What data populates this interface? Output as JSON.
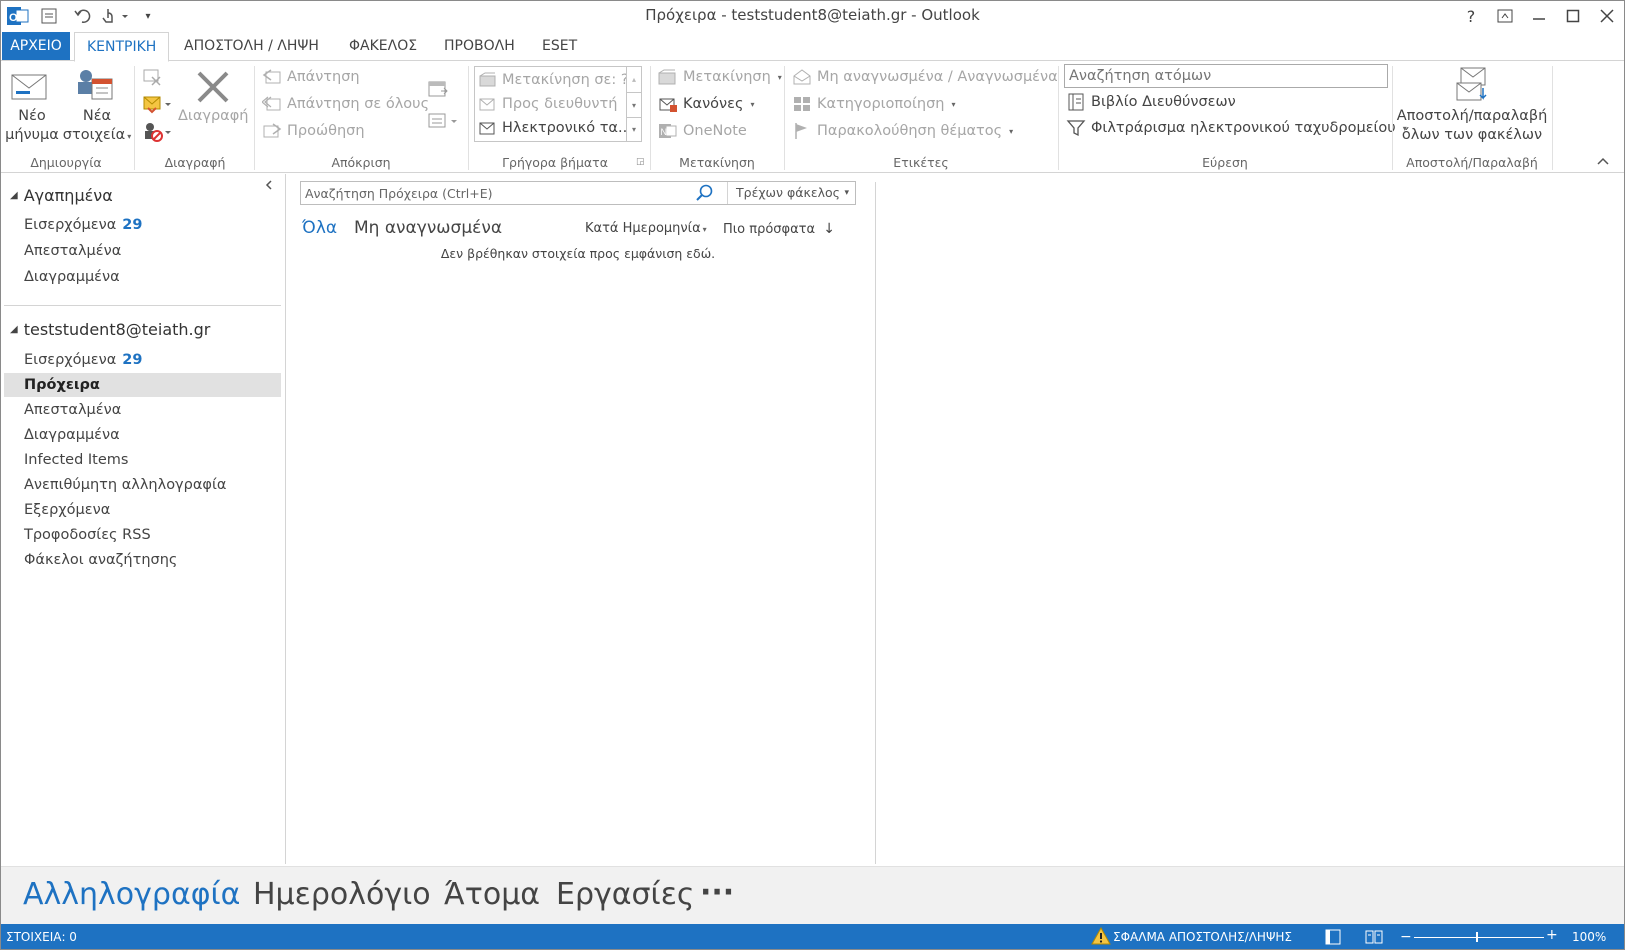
{
  "window": {
    "title": "Πρόχειρα - teststudent8@teiath.gr - Outlook",
    "help": "?"
  },
  "tabs": {
    "file": "ΑΡΧΕΙΟ",
    "home": "ΚΕΝΤΡΙΚΗ",
    "send_receive": "ΑΠΟΣΤΟΛΗ / ΛΗΨΗ",
    "folder": "ΦΑΚΕΛΟΣ",
    "view": "ΠΡΟΒΟΛΗ",
    "eset": "ESET"
  },
  "ribbon": {
    "new": {
      "new_email_line1": "Νέο",
      "new_email_line2": "μήνυμα",
      "new_items_line1": "Νέα",
      "new_items_line2": "στοιχεία",
      "label": "Δημιουργία"
    },
    "delete": {
      "delete": "Διαγραφή",
      "label": "Διαγραφή"
    },
    "respond": {
      "reply": "Απάντηση",
      "reply_all": "Απάντηση σε όλους",
      "forward": "Προώθηση",
      "label": "Απόκριση"
    },
    "quick_steps": {
      "move_to": "Μετακίνηση σε: ?",
      "to_manager": "Προς διευθυντή",
      "team_email": "Ηλεκτρονικό τα...",
      "label": "Γρήγορα βήματα"
    },
    "move": {
      "move": "Μετακίνηση",
      "rules": "Κανόνες",
      "onenote": "OneNote",
      "label": "Μετακίνηση"
    },
    "tags": {
      "unread_read": "Μη αναγνωσμένα / Αναγνωσμένα",
      "categorize": "Κατηγοριοποίηση",
      "follow_up": "Παρακολούθηση θέματος",
      "label": "Ετικέτες"
    },
    "find": {
      "search_people_placeholder": "Αναζήτηση ατόμων",
      "address_book": "Βιβλίο Διευθύνσεων",
      "filter_email": "Φιλτράρισμα ηλεκτρονικού ταχυδρομείου",
      "label": "Εύρεση"
    },
    "send_receive": {
      "line1": "Αποστολή/παραλαβή",
      "line2": "όλων των φακέλων",
      "label": "Αποστολή/Παραλαβή"
    }
  },
  "nav": {
    "favorites": {
      "title": "Αγαπημένα",
      "items": [
        {
          "label": "Εισερχόμενα",
          "count": "29"
        },
        {
          "label": "Απεσταλμένα",
          "count": ""
        },
        {
          "label": "Διαγραμμένα",
          "count": ""
        }
      ]
    },
    "account": {
      "title": "teststudent8@teiath.gr",
      "items": [
        {
          "label": "Εισερχόμενα",
          "count": "29"
        },
        {
          "label": "Πρόχειρα",
          "count": ""
        },
        {
          "label": "Απεσταλμένα",
          "count": ""
        },
        {
          "label": "Διαγραμμένα",
          "count": ""
        },
        {
          "label": "Infected Items",
          "count": ""
        },
        {
          "label": "Ανεπιθύμητη αλληλογραφία",
          "count": ""
        },
        {
          "label": "Εξερχόμενα",
          "count": ""
        },
        {
          "label": "Τροφοδοσίες RSS",
          "count": ""
        },
        {
          "label": "Φάκελοι αναζήτησης",
          "count": ""
        }
      ]
    }
  },
  "list": {
    "search_placeholder": "Αναζήτηση Πρόχειρα (Ctrl+E)",
    "scope": "Τρέχων φάκελος",
    "filter_all": "Όλα",
    "filter_unread": "Μη αναγνωσμένα",
    "sort_by": "Κατά Ημερομηνία",
    "sort_order": "Πιο πρόσφατα",
    "empty": "Δεν βρέθηκαν στοιχεία προς εμφάνιση εδώ."
  },
  "bottom_nav": {
    "mail": "Αλληλογραφία",
    "calendar": "Ημερολόγιο",
    "people": "Άτομα",
    "tasks": "Εργασίες",
    "more": "···"
  },
  "status": {
    "items": "ΣΤΟΙΧΕΙΑ: 0",
    "error": "ΣΦΑΛΜΑ ΑΠΟΣΤΟΛΗΣ/ΛΗΨΗΣ",
    "zoom": "100%"
  },
  "colors": {
    "accent": "#1e72c2",
    "selected_bg": "#e1e1e1",
    "bottom_nav_bg": "#f1f1f1"
  }
}
